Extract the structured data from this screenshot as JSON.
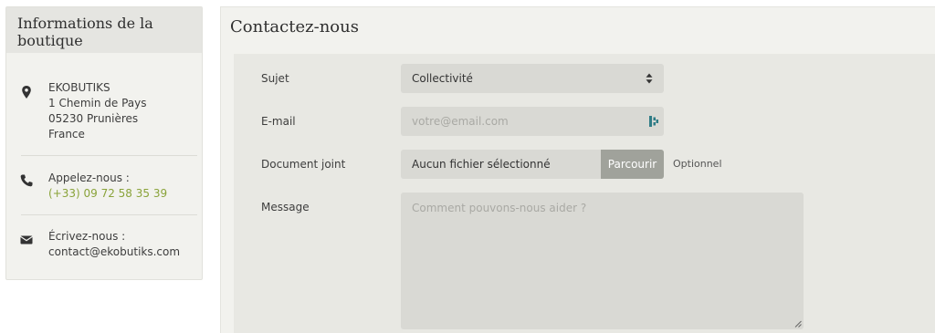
{
  "sidebar": {
    "title": "Informations de la boutique",
    "address": {
      "icon": "map-marker-icon",
      "lines": [
        "EKOBUTIKS",
        "1 Chemin de Pays",
        "05230 Prunières",
        "France"
      ]
    },
    "phone": {
      "icon": "phone-icon",
      "label": "Appelez-nous :",
      "number": "(+33) 09 72 58 35 39"
    },
    "email": {
      "icon": "envelope-icon",
      "label": "Écrivez-nous :",
      "address": "contact@ekobutiks.com"
    }
  },
  "contact": {
    "title": "Contactez-nous",
    "subject": {
      "label": "Sujet",
      "value": "Collectivité",
      "icon": "select-arrows-icon"
    },
    "email": {
      "label": "E-mail",
      "placeholder": "votre@email.com",
      "icon": "password-manager-icon"
    },
    "attachment": {
      "label": "Document joint",
      "file_name": "Aucun fichier sélectionné",
      "browse_label": "Parcourir",
      "optional_label": "Optionnel"
    },
    "message": {
      "label": "Message",
      "placeholder": "Comment pouvons-nous aider ?"
    }
  },
  "colors": {
    "accent_link": "#8aa33a",
    "panel_bg": "#f2f2ee",
    "field_bg": "#d9d9d4",
    "browse_button_bg": "#a0a29b"
  }
}
